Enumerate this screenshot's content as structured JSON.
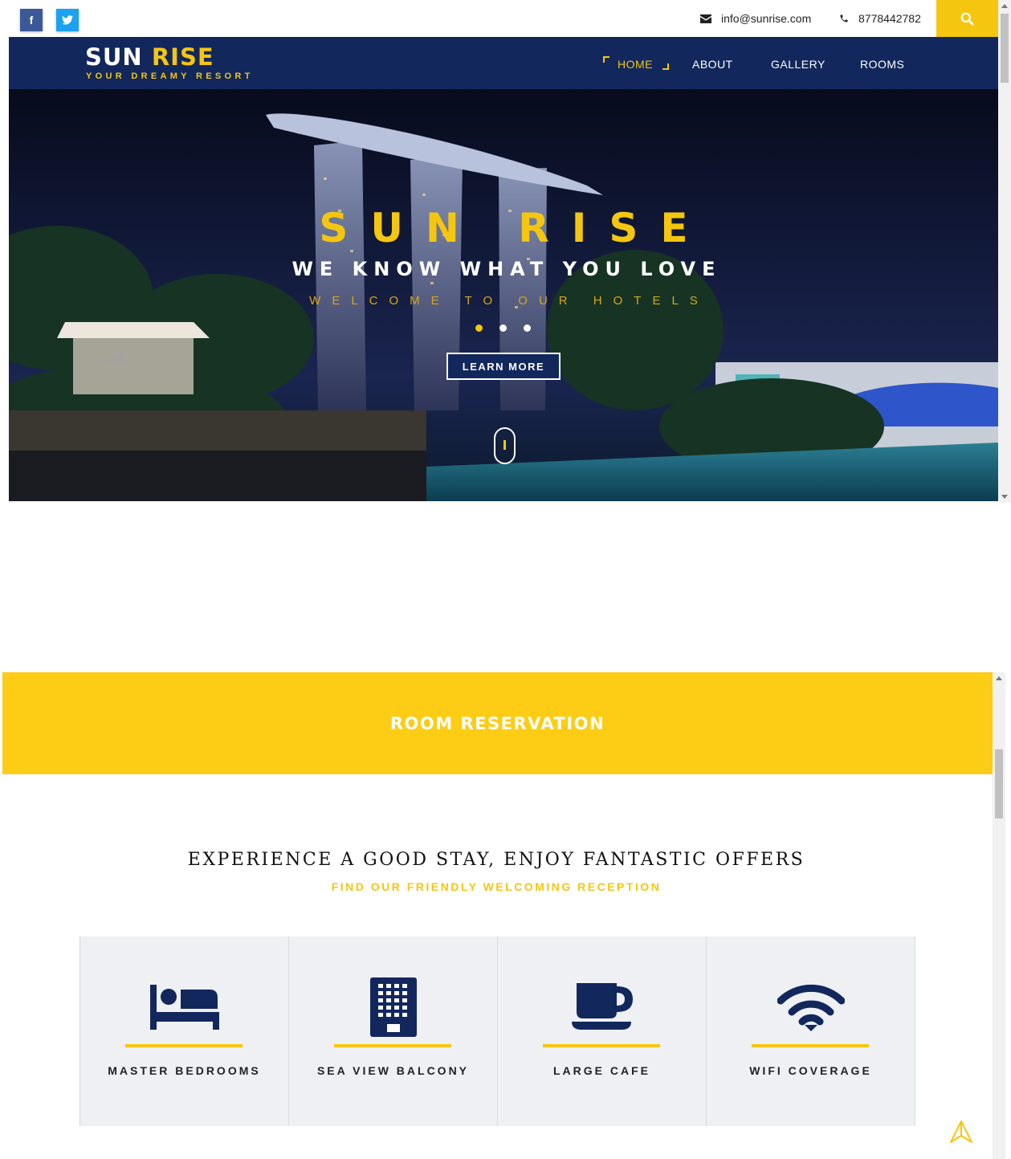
{
  "colors": {
    "navy": "#12275c",
    "gold": "#f5c60f",
    "yellow_band": "#fdcd15"
  },
  "topbar": {
    "social": [
      {
        "name": "facebook",
        "glyph": "f",
        "icon": "facebook-icon"
      },
      {
        "name": "twitter",
        "glyph": "t",
        "icon": "twitter-icon"
      }
    ],
    "email": "info@sunrise.com",
    "phone": "8778442782",
    "search_icon": "search-icon"
  },
  "brand": {
    "name_part1": "SUN",
    "name_part2": "RISE",
    "tagline": "YOUR DREAMY RESORT"
  },
  "nav": {
    "items": [
      {
        "label": "HOME",
        "active": true
      },
      {
        "label": "ABOUT"
      },
      {
        "label": "GALLERY"
      },
      {
        "label": "ROOMS"
      }
    ]
  },
  "hero": {
    "title": "SUN RISE",
    "tagline": "WE KNOW WHAT YOU LOVE",
    "welcome": "WELCOME TO OUR HOTELS",
    "slides": 3,
    "active_slide": 1,
    "cta_label": "LEARN MORE"
  },
  "reservation": {
    "label": "ROOM RESERVATION"
  },
  "offers": {
    "title": "EXPERIENCE A GOOD STAY, ENJOY FANTASTIC OFFERS",
    "subtitle": "FIND OUR FRIENDLY WELCOMING RECEPTION"
  },
  "features": [
    {
      "label": "MASTER BEDROOMS",
      "icon": "bed-icon"
    },
    {
      "label": "SEA VIEW BALCONY",
      "icon": "building-icon"
    },
    {
      "label": "LARGE CAFE",
      "icon": "coffee-cup-icon"
    },
    {
      "label": "WIFI COVERAGE",
      "icon": "wifi-icon"
    }
  ]
}
